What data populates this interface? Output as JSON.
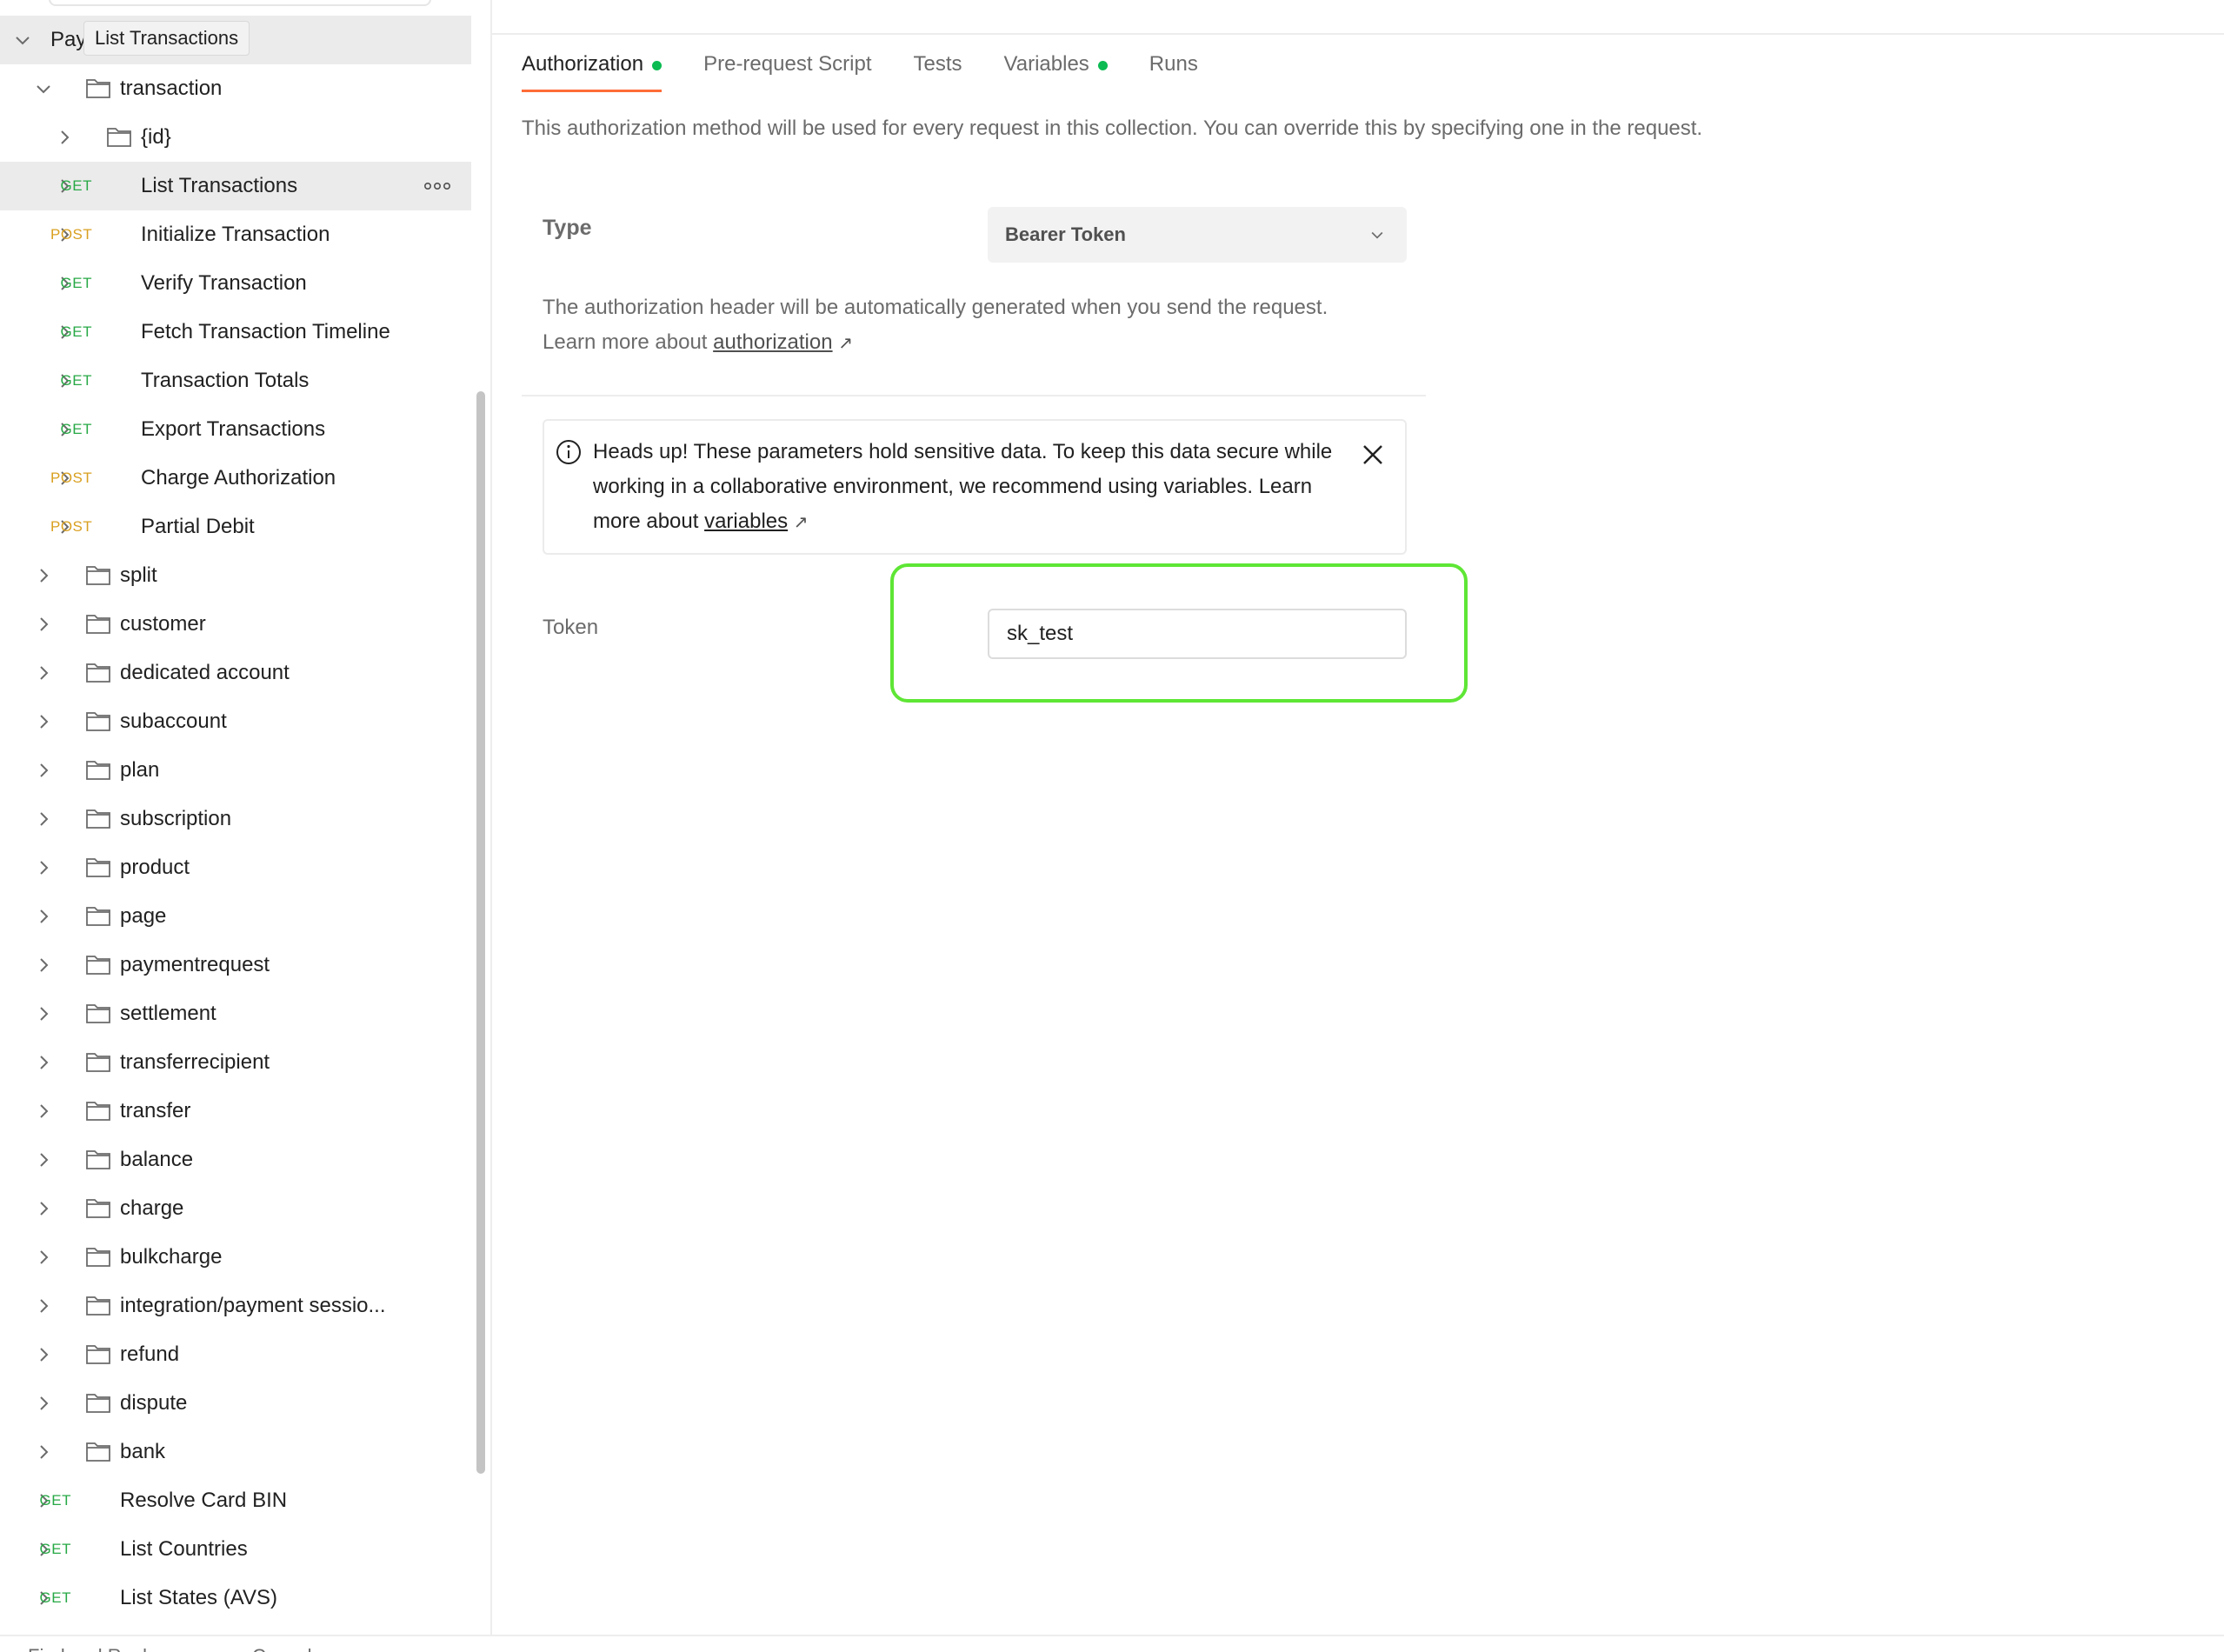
{
  "sidebar": {
    "tooltip": "List Transactions",
    "root_label": "Pay",
    "items": [
      {
        "label": "transaction",
        "kind": "folder",
        "level": 1,
        "expanded": true
      },
      {
        "label": "{id}",
        "kind": "folder",
        "level": 2,
        "expanded": false
      },
      {
        "label": "List Transactions",
        "kind": "request",
        "method": "GET",
        "level": 2,
        "selected": true
      },
      {
        "label": "Initialize Transaction",
        "kind": "request",
        "method": "POST",
        "level": 2
      },
      {
        "label": "Verify Transaction",
        "kind": "request",
        "method": "GET",
        "level": 2
      },
      {
        "label": "Fetch Transaction Timeline",
        "kind": "request",
        "method": "GET",
        "level": 2
      },
      {
        "label": "Transaction Totals",
        "kind": "request",
        "method": "GET",
        "level": 2
      },
      {
        "label": "Export Transactions",
        "kind": "request",
        "method": "GET",
        "level": 2
      },
      {
        "label": "Charge Authorization",
        "kind": "request",
        "method": "POST",
        "level": 2
      },
      {
        "label": "Partial Debit",
        "kind": "request",
        "method": "POST",
        "level": 2
      },
      {
        "label": "split",
        "kind": "folder",
        "level": 1
      },
      {
        "label": "customer",
        "kind": "folder",
        "level": 1
      },
      {
        "label": "dedicated account",
        "kind": "folder",
        "level": 1
      },
      {
        "label": "subaccount",
        "kind": "folder",
        "level": 1
      },
      {
        "label": "plan",
        "kind": "folder",
        "level": 1
      },
      {
        "label": "subscription",
        "kind": "folder",
        "level": 1
      },
      {
        "label": "product",
        "kind": "folder",
        "level": 1
      },
      {
        "label": "page",
        "kind": "folder",
        "level": 1
      },
      {
        "label": "paymentrequest",
        "kind": "folder",
        "level": 1
      },
      {
        "label": "settlement",
        "kind": "folder",
        "level": 1
      },
      {
        "label": "transferrecipient",
        "kind": "folder",
        "level": 1
      },
      {
        "label": "transfer",
        "kind": "folder",
        "level": 1
      },
      {
        "label": "balance",
        "kind": "folder",
        "level": 1
      },
      {
        "label": "charge",
        "kind": "folder",
        "level": 1
      },
      {
        "label": "bulkcharge",
        "kind": "folder",
        "level": 1
      },
      {
        "label": "integration/payment sessio...",
        "kind": "folder",
        "level": 1
      },
      {
        "label": "refund",
        "kind": "folder",
        "level": 1
      },
      {
        "label": "dispute",
        "kind": "folder",
        "level": 1
      },
      {
        "label": "bank",
        "kind": "folder",
        "level": 1
      },
      {
        "label": "Resolve Card BIN",
        "kind": "request",
        "method": "GET",
        "level": 1
      },
      {
        "label": "List Countries",
        "kind": "request",
        "method": "GET",
        "level": 1
      },
      {
        "label": "List States (AVS)",
        "kind": "request",
        "method": "GET",
        "level": 1
      }
    ]
  },
  "tabs": [
    {
      "label": "Authorization",
      "active": true,
      "dot": true
    },
    {
      "label": "Pre-request Script",
      "active": false,
      "dot": false
    },
    {
      "label": "Tests",
      "active": false,
      "dot": false
    },
    {
      "label": "Variables",
      "active": false,
      "dot": true
    },
    {
      "label": "Runs",
      "active": false,
      "dot": false
    }
  ],
  "auth": {
    "description": "This authorization method will be used for every request in this collection. You can override this by specifying one in the request.",
    "type_label": "Type",
    "type_value": "Bearer Token",
    "help_text": "The authorization header will be automatically generated when you send the request. Learn more about",
    "help_link": "authorization",
    "alert_text": "Heads up! These parameters hold sensitive data. To keep this data secure while working in a collaborative environment, we recommend using variables. Learn more about",
    "alert_link": "variables",
    "token_label": "Token",
    "token_value": "sk_test"
  },
  "footer": {
    "find_replace": "Find and Replace",
    "console": "Console"
  },
  "colors": {
    "accent": "#ff6c37",
    "get": "#27a845",
    "post": "#d9a020",
    "dot": "#0cbb52",
    "highlight": "#5ee635"
  }
}
